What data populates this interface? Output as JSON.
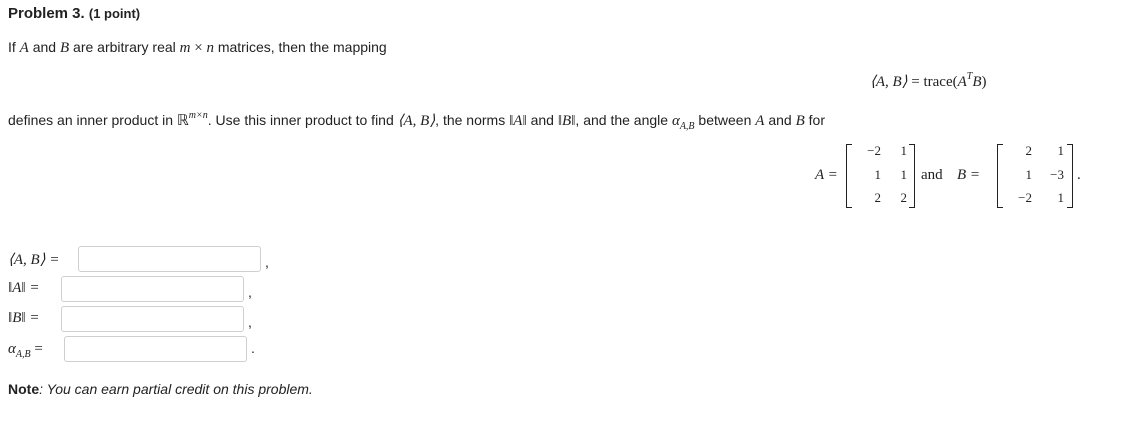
{
  "problem": {
    "number_label": "Problem 3.",
    "points_label": "(1 point)"
  },
  "intro": {
    "text1": "If ",
    "A": "A",
    "and1": " and ",
    "B": "B",
    "text2": " are arbitrary real ",
    "m": "m",
    "times": " × ",
    "n": "n",
    "text3": " matrices, then the mapping"
  },
  "display_formula": {
    "lhs": "⟨A, B⟩",
    "eq": " = trace(",
    "A": "A",
    "T": "T",
    "B": "B",
    "close": ")"
  },
  "defines": {
    "text1": "defines an inner product in ",
    "R": "ℝ",
    "sup": "m×n",
    "text2": ". Use this inner product to find ",
    "ip": "⟨A, B⟩",
    "text3": ", the norms ",
    "normA": "‖A‖",
    "and1": " and ",
    "normB": "‖B‖",
    "text4": ", and the angle ",
    "alpha": "α",
    "alpha_sub": "A,B",
    "text5": " between ",
    "A": "A",
    "and2": " and ",
    "B": "B",
    "text6": " for"
  },
  "matrices": {
    "A_label": "A =",
    "A": [
      [
        "−2",
        "1"
      ],
      [
        "1",
        "1"
      ],
      [
        "2",
        "2"
      ]
    ],
    "and": "and",
    "B_label": "B =",
    "B": [
      [
        "2",
        "1"
      ],
      [
        "1",
        "−3"
      ],
      [
        "−2",
        "1"
      ]
    ],
    "end": "."
  },
  "answers": [
    {
      "label": "⟨A, B⟩ =",
      "value": "",
      "punct": ","
    },
    {
      "label": "‖A‖ =",
      "value": "",
      "punct": ","
    },
    {
      "label": "‖B‖ =",
      "value": "",
      "punct": ","
    },
    {
      "label_main": "α",
      "label_sub": "A,B",
      "label_eq": " =",
      "value": "",
      "punct": "."
    }
  ],
  "note": {
    "bold": "Note",
    "text": ": You can earn partial credit on this problem."
  }
}
